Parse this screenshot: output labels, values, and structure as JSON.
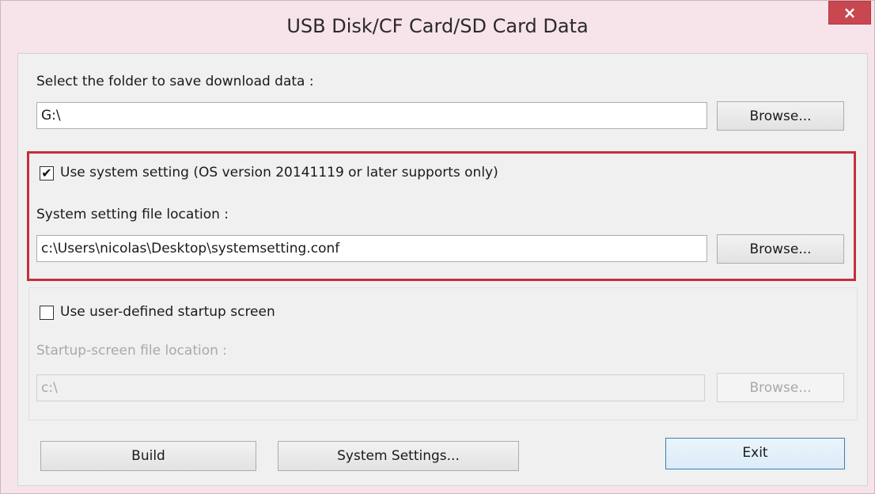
{
  "window": {
    "title": "USB Disk/CF Card/SD Card Data",
    "close_glyph": "×",
    "accent_close_color": "#c9484f",
    "highlight_color": "#c62f3a"
  },
  "download": {
    "label": "Select the folder to save download data :",
    "path": "G:\\",
    "browse": "Browse..."
  },
  "system_setting": {
    "checkbox_label": "Use system setting (OS version 20141119 or later supports only)",
    "checked": true,
    "check_glyph": "✔",
    "file_label": "System setting file location :",
    "path": "c:\\Users\\nicolas\\Desktop\\systemsetting.conf",
    "browse": "Browse..."
  },
  "startup_screen": {
    "checkbox_label": "Use user-defined startup screen",
    "checked": false,
    "file_label": "Startup-screen file location :",
    "path": "c:\\",
    "browse": "Browse..."
  },
  "footer": {
    "build": "Build",
    "system_settings": "System Settings...",
    "exit": "Exit"
  }
}
